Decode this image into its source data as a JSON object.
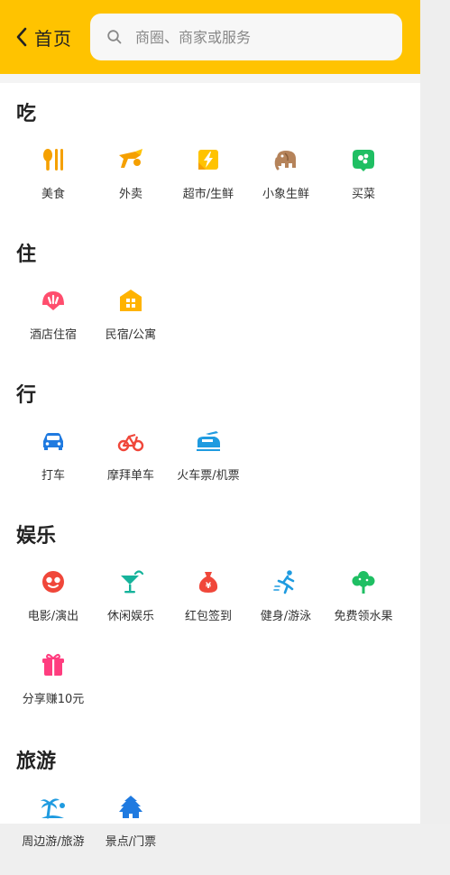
{
  "header": {
    "back_label": "首页",
    "search_placeholder": "商圈、商家或服务"
  },
  "colors": {
    "header_bg": "#ffc300",
    "orange": "#f5a000",
    "green": "#1fbf63",
    "red": "#f0473a",
    "blue": "#1f7ae0",
    "pink": "#ff4d6d",
    "teal": "#16b39b",
    "brown": "#b5835a"
  },
  "sections": [
    {
      "title": "吃",
      "items": [
        {
          "label": "美食",
          "icon": "fork-knife-icon"
        },
        {
          "label": "外卖",
          "icon": "delivery-icon"
        },
        {
          "label": "超市/生鲜",
          "icon": "supermarket-icon"
        },
        {
          "label": "小象生鲜",
          "icon": "elephant-icon"
        },
        {
          "label": "买菜",
          "icon": "vegetable-icon"
        }
      ]
    },
    {
      "title": "住",
      "items": [
        {
          "label": "酒店住宿",
          "icon": "hotel-icon"
        },
        {
          "label": "民宿/公寓",
          "icon": "apartment-icon"
        }
      ]
    },
    {
      "title": "行",
      "items": [
        {
          "label": "打车",
          "icon": "car-icon"
        },
        {
          "label": "摩拜单车",
          "icon": "bike-icon"
        },
        {
          "label": "火车票/机票",
          "icon": "train-icon"
        }
      ]
    },
    {
      "title": "娱乐",
      "items": [
        {
          "label": "电影/演出",
          "icon": "movie-icon"
        },
        {
          "label": "休闲娱乐",
          "icon": "cocktail-icon"
        },
        {
          "label": "红包签到",
          "icon": "money-bag-icon"
        },
        {
          "label": "健身/游泳",
          "icon": "runner-icon"
        },
        {
          "label": "免费领水果",
          "icon": "tree-icon"
        },
        {
          "label": "分享赚10元",
          "icon": "gift-icon"
        }
      ]
    },
    {
      "title": "旅游",
      "items": [
        {
          "label": "周边游/旅游",
          "icon": "palm-tree-icon"
        },
        {
          "label": "景点/门票",
          "icon": "temple-icon"
        }
      ]
    }
  ]
}
